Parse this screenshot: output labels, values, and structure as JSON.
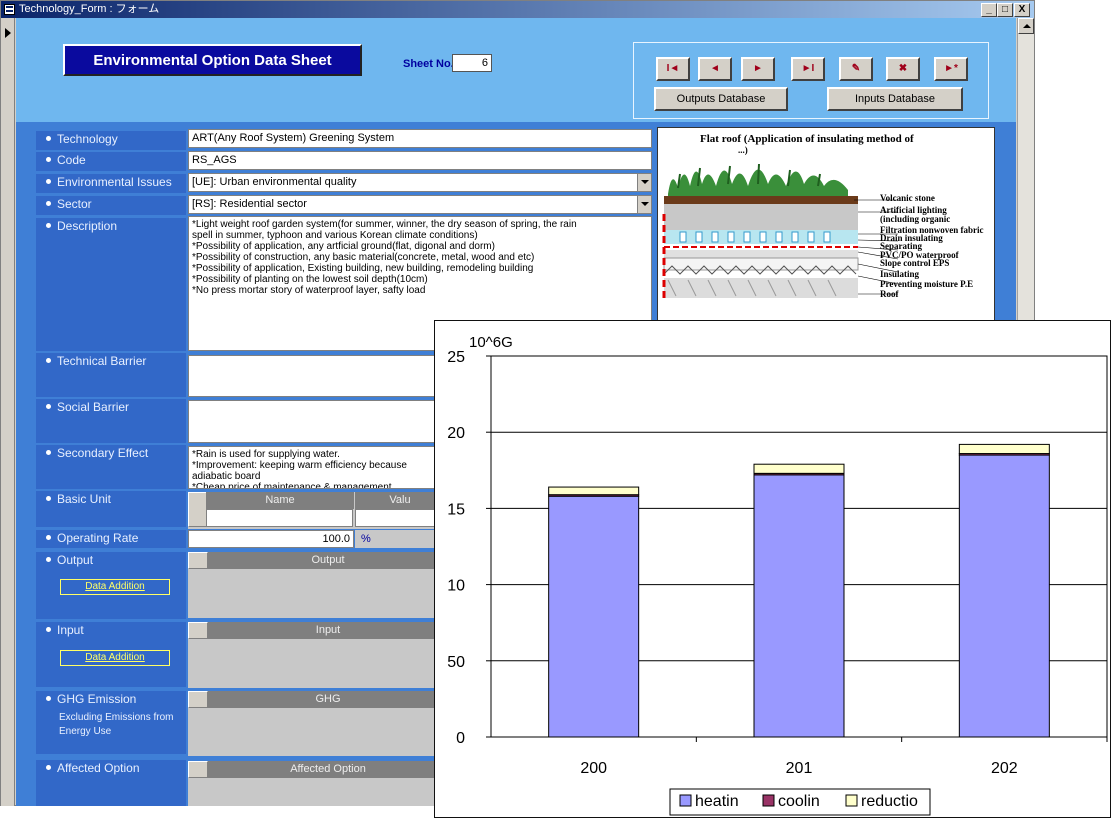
{
  "window": {
    "title": "Technology_Form : フォーム",
    "buttons": {
      "minimize": "_",
      "maximize": "□",
      "close": "X"
    }
  },
  "header": {
    "form_title": "Environmental Option Data Sheet",
    "sheet_label": "Sheet No.:",
    "sheet_no": "6",
    "nav_buttons": [
      {
        "icon": "first-record-icon",
        "glyph": "I◄"
      },
      {
        "icon": "prev-record-icon",
        "glyph": "◄"
      },
      {
        "icon": "next-record-icon",
        "glyph": "►"
      },
      {
        "icon": "last-record-icon",
        "glyph": "►I"
      },
      {
        "icon": "save-record-icon",
        "glyph": "✎"
      },
      {
        "icon": "delete-record-icon",
        "glyph": "✖"
      },
      {
        "icon": "new-record-icon",
        "glyph": "►*"
      }
    ],
    "outputs_db": "Outputs Database",
    "inputs_db": "Inputs Database"
  },
  "fields": {
    "technology": {
      "label": "Technology",
      "value": "ART(Any Roof System) Greening System"
    },
    "code": {
      "label": "Code",
      "value": "RS_AGS"
    },
    "env_issues": {
      "label": "Environmental Issues",
      "value": "[UE]: Urban environmental quality"
    },
    "sector": {
      "label": "Sector",
      "value": "[RS]: Residential sector"
    },
    "description": {
      "label": "Description",
      "value": "*Light weight roof garden system(for summer, winner, the dry season of spring, the rain\nspell in summer, typhoon and various Korean climate conditions)\n*Possibility of application, any artficial ground(flat, digonal and dorm)\n*Possibility of construction, any basic material(concrete, metal, wood and etc)\n*Possibility of application, Existing building, new building, remodeling building\n*Possibility of planting on the lowest soil depth(10cm)\n*No press mortar story of waterproof layer, safty load"
    },
    "technical_barrier": {
      "label": "Technical Barrier",
      "value": ""
    },
    "social_barrier": {
      "label": "Social Barrier",
      "value": ""
    },
    "secondary_effect": {
      "label": "Secondary Effect",
      "value": "*Rain is used for supplying water.\n*Improvement: keeping warm efficiency because\nadiabatic board\n*Cheap price of maintenance & management"
    },
    "basic_unit": {
      "label": "Basic Unit",
      "col_name": "Name",
      "col_value": "Valu"
    },
    "operating_rate": {
      "label": "Operating Rate",
      "value": "100.0",
      "unit": "%"
    },
    "output": {
      "label": "Output",
      "header": "Output",
      "button": "Data Addition"
    },
    "input": {
      "label": "Input",
      "header": "Input",
      "button": "Data Addition"
    },
    "ghg": {
      "label": "GHG Emission",
      "sub": "Excluding Emissions from Energy Use",
      "header": "GHG"
    },
    "affected": {
      "label": "Affected Option",
      "header": "Affected Option"
    }
  },
  "roof_image": {
    "title": "Flat roof (Application of insulating method of",
    "title_cut": "                 ...)",
    "labels": [
      "Volcanic stone",
      "Artificial lighting",
      "(including organic",
      "Filtration nonwoven fabric",
      "Drain insulating",
      "Separating",
      "PVC/PO waterproof",
      "Slope control EPS",
      "Insulating",
      "Preventing moisture P.E",
      "Roof"
    ]
  },
  "chart_data": {
    "type": "bar",
    "stacked": true,
    "unit_label": "10^6G",
    "categories": [
      "200",
      "201",
      "202"
    ],
    "y_tick_labels": [
      "0",
      "50",
      "10",
      "15",
      "20",
      "25"
    ],
    "ylim": [
      0,
      25
    ],
    "grid": true,
    "legend_position": "bottom",
    "series": [
      {
        "name": "heatin",
        "color": "#9999ff",
        "values": [
          15.8,
          17.2,
          18.5
        ]
      },
      {
        "name": "coolin",
        "color": "#993366",
        "values": [
          0.1,
          0.1,
          0.1
        ]
      },
      {
        "name": "reductio",
        "color": "#ffffcc",
        "values": [
          0.5,
          0.6,
          0.6
        ]
      }
    ]
  }
}
